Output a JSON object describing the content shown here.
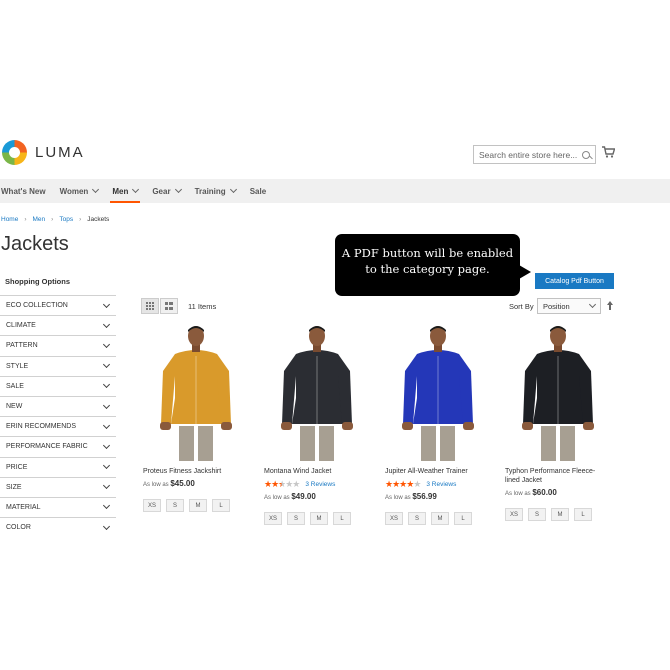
{
  "header": {
    "logo_text": "LUMA",
    "search_placeholder": "Search entire store here..."
  },
  "nav": [
    {
      "label": "What's New",
      "has_menu": false,
      "active": false
    },
    {
      "label": "Women",
      "has_menu": true,
      "active": false
    },
    {
      "label": "Men",
      "has_menu": true,
      "active": true
    },
    {
      "label": "Gear",
      "has_menu": true,
      "active": false
    },
    {
      "label": "Training",
      "has_menu": true,
      "active": false
    },
    {
      "label": "Sale",
      "has_menu": false,
      "active": false
    }
  ],
  "breadcrumb": [
    "Home",
    "Men",
    "Tops",
    "Jackets"
  ],
  "page_title": "Jackets",
  "annotation": {
    "line1": "A PDF button will be enabled",
    "line2": "to the category page."
  },
  "pdf_button_label": "Catalog Pdf Button",
  "sidebar": {
    "title": "Shopping Options",
    "filters": [
      "ECO COLLECTION",
      "CLIMATE",
      "PATTERN",
      "STYLE",
      "SALE",
      "NEW",
      "ERIN RECOMMENDS",
      "PERFORMANCE FABRIC",
      "PRICE",
      "SIZE",
      "MATERIAL",
      "COLOR"
    ]
  },
  "toolbar": {
    "item_count": "11 Items",
    "sort_label": "Sort By",
    "sort_value": "Position"
  },
  "products": [
    {
      "name": "Proteus Fitness Jackshirt",
      "price_prefix": "As low as",
      "price": "$45.00",
      "rating": null,
      "reviews": null,
      "jacket_color": "#d99a2b",
      "sizes": [
        "XS",
        "S",
        "M",
        "L"
      ]
    },
    {
      "name": "Montana Wind Jacket",
      "price_prefix": "As low as",
      "price": "$49.00",
      "rating": 2.5,
      "reviews": "3  Reviews",
      "jacket_color": "#2b2d33",
      "sizes": [
        "XS",
        "S",
        "M",
        "L"
      ]
    },
    {
      "name": "Jupiter All-Weather Trainer",
      "price_prefix": "As low as",
      "price": "$56.99",
      "rating": 4,
      "reviews": "3  Reviews",
      "jacket_color": "#2437b8",
      "sizes": [
        "XS",
        "S",
        "M",
        "L"
      ]
    },
    {
      "name": "Typhon Performance Fleece-lined Jacket",
      "price_prefix": "As low as",
      "price": "$60.00",
      "rating": null,
      "reviews": null,
      "jacket_color": "#1d1f24",
      "sizes": [
        "XS",
        "S",
        "M",
        "L"
      ]
    }
  ],
  "colors": {
    "accent": "#1979c3",
    "active_underline": "#ff5501",
    "star_on": "#ff5501"
  }
}
